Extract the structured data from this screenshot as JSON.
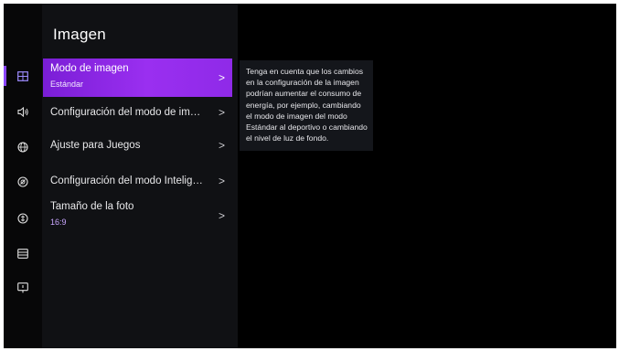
{
  "panel": {
    "title": "Imagen",
    "items": [
      {
        "label": "Modo de imagen",
        "value": "Estándar",
        "chevron": ">"
      },
      {
        "label": "Configuración del modo de im…",
        "chevron": ">"
      },
      {
        "label": "Ajuste para Juegos",
        "chevron": ">"
      },
      {
        "label": "Configuración del modo Intelig…",
        "chevron": ">"
      },
      {
        "label": "Tamaño de la foto",
        "value": "16:9",
        "chevron": ">"
      }
    ]
  },
  "info": {
    "text": "Tenga en cuenta que los cambios en la configuración de la imagen podrían aumentar el consumo de energía, por ejemplo, cambiando el modo de imagen del modo Estándar al deportivo o cambiando el nivel de luz de fondo."
  },
  "sidebar": {
    "icons": [
      "picture-icon",
      "speaker-icon",
      "globe-icon",
      "accessibility-icon",
      "power-saving-icon",
      "list-icon",
      "support-icon"
    ]
  },
  "colors": {
    "accent": "#8a45ff",
    "selected_gradient_start": "#7a1ed6",
    "selected_gradient_end": "#9a2ff0",
    "panel_bg": "#101114",
    "screen_bg": "#000000"
  }
}
